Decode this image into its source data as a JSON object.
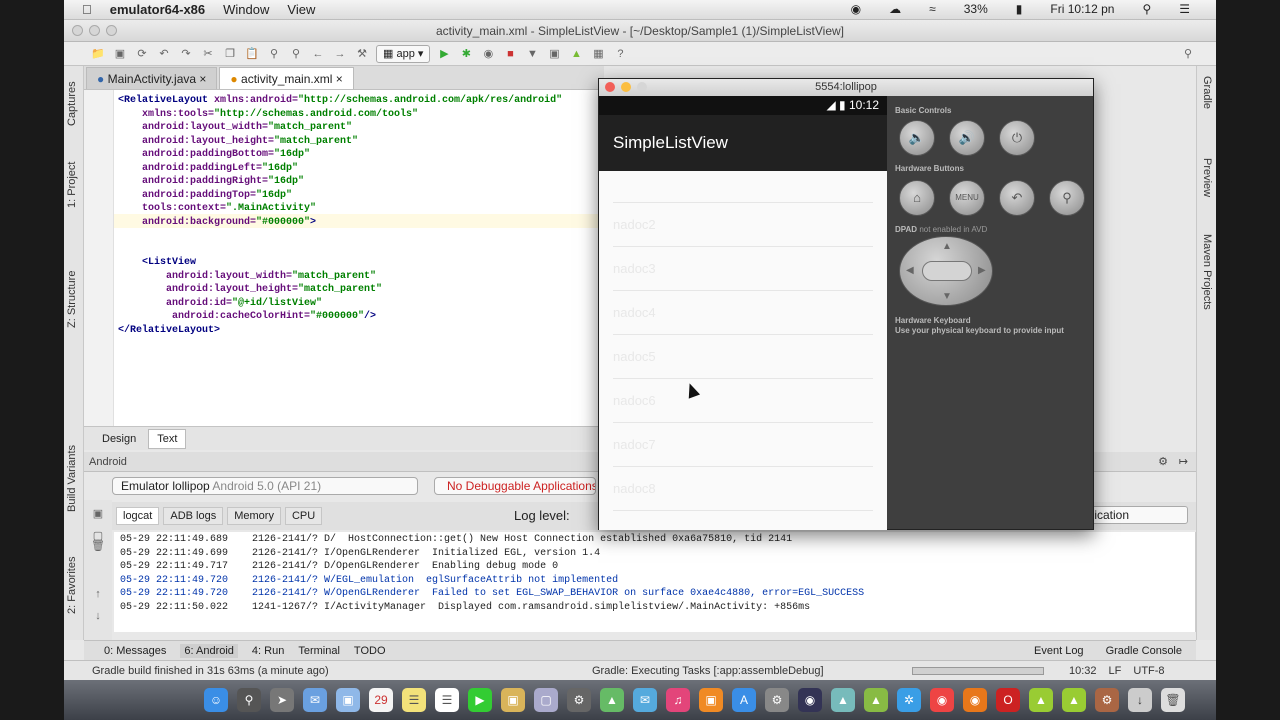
{
  "menubar": {
    "apple": "",
    "app_name": "emulator64-x86",
    "items": [
      "Window",
      "View"
    ],
    "battery": "33%",
    "clock": "Fri 10:12 pn"
  },
  "window": {
    "title": "activity_main.xml - SimpleListView - [~/Desktop/Sample1 (1)/SimpleListView]"
  },
  "toolbar": {
    "run_config": "app"
  },
  "left_tabs": [
    "Captures",
    "1: Project",
    "Z: Structure",
    "Build Variants",
    "2: Favorites"
  ],
  "right_tabs": [
    "Gradle",
    "Preview",
    "Maven Projects"
  ],
  "editor_tabs": [
    {
      "label": "MainActivity.java"
    },
    {
      "label": "activity_main.xml"
    }
  ],
  "code": [
    {
      "indent": 0,
      "tag": "<RelativeLayout",
      "attr": " xmlns:android=",
      "val": "\"http://schemas.android.com/apk/res/android\"",
      "end": ""
    },
    {
      "indent": 1,
      "tag": "",
      "attr": "xmlns:tools=",
      "val": "\"http://schemas.android.com/tools\"",
      "end": ""
    },
    {
      "indent": 1,
      "tag": "",
      "attr": "android:layout_width=",
      "val": "\"match_parent\"",
      "end": ""
    },
    {
      "indent": 1,
      "tag": "",
      "attr": "android:layout_height=",
      "val": "\"match_parent\"",
      "end": ""
    },
    {
      "indent": 1,
      "tag": "",
      "attr": "android:paddingBottom=",
      "val": "\"16dp\"",
      "end": ""
    },
    {
      "indent": 1,
      "tag": "",
      "attr": "android:paddingLeft=",
      "val": "\"16dp\"",
      "end": ""
    },
    {
      "indent": 1,
      "tag": "",
      "attr": "android:paddingRight=",
      "val": "\"16dp\"",
      "end": ""
    },
    {
      "indent": 1,
      "tag": "",
      "attr": "android:paddingTop=",
      "val": "\"16dp\"",
      "end": ""
    },
    {
      "indent": 1,
      "tag": "",
      "attr": "tools:context=",
      "val": "\".MainActivity\"",
      "end": ""
    },
    {
      "indent": 1,
      "tag": "",
      "attr": "android:background=",
      "val": "\"#000000\"",
      "end": ">"
    },
    {
      "indent": 0,
      "tag": "",
      "attr": "",
      "val": "",
      "end": ""
    },
    {
      "indent": 0,
      "tag": "",
      "attr": "",
      "val": "",
      "end": ""
    },
    {
      "indent": 1,
      "tag": "<ListView",
      "attr": "",
      "val": "",
      "end": ""
    },
    {
      "indent": 2,
      "tag": "",
      "attr": "android:layout_width=",
      "val": "\"match_parent\"",
      "end": ""
    },
    {
      "indent": 2,
      "tag": "",
      "attr": "android:layout_height=",
      "val": "\"match_parent\"",
      "end": ""
    },
    {
      "indent": 2,
      "tag": "",
      "attr": "android:id=",
      "val": "\"@+id/listView\"",
      "end": ""
    },
    {
      "indent": 2,
      "tag": "",
      "attr": " android:cacheColorHint=",
      "val": "\"#000000\"",
      "end": "/>"
    },
    {
      "indent": 0,
      "tag": "</RelativeLayout>",
      "attr": "",
      "val": "",
      "end": ""
    }
  ],
  "design_tabs": {
    "design": "Design",
    "text": "Text"
  },
  "android_panel": {
    "title": "Android",
    "device_name": "Emulator lollipop",
    "device_api": "Android 5.0 (API 21)",
    "process": "No Debuggable Applications",
    "log_tabs": [
      "logcat",
      "ADB logs",
      "Memory",
      "CPU"
    ],
    "log_level_label": "Log level:",
    "filter": "plication"
  },
  "log_lines": [
    {
      "level": "d",
      "text": "05-29 22:11:49.689    2126-2141/? D/  HostConnection::get() New Host Connection established 0xa6a75810, tid 2141"
    },
    {
      "level": "i",
      "text": "05-29 22:11:49.699    2126-2141/? I/OpenGLRenderer  Initialized EGL, version 1.4"
    },
    {
      "level": "d",
      "text": "05-29 22:11:49.717    2126-2141/? D/OpenGLRenderer  Enabling debug mode 0"
    },
    {
      "level": "w",
      "text": "05-29 22:11:49.720    2126-2141/? W/EGL_emulation  eglSurfaceAttrib not implemented"
    },
    {
      "level": "w",
      "text": "05-29 22:11:49.720    2126-2141/? W/OpenGLRenderer  Failed to set EGL_SWAP_BEHAVIOR on surface 0xae4c4880, error=EGL_SUCCESS"
    },
    {
      "level": "i",
      "text": "05-29 22:11:50.022    1241-1267/? I/ActivityManager  Displayed com.ramsandroid.simplelistview/.MainActivity: +856ms"
    }
  ],
  "bottom_tabs": {
    "left": [
      "0: Messages",
      "6: Android",
      "4: Run",
      "Terminal",
      "TODO"
    ],
    "right": [
      "Event Log",
      "Gradle Console"
    ]
  },
  "status": {
    "left": "Gradle build finished in 31s 63ms (a minute ago)",
    "middle": "Gradle: Executing Tasks [:app:assembleDebug]",
    "time": "10:32",
    "lf": "LF",
    "encoding": "UTF-8"
  },
  "emulator": {
    "title": "5554:lollipop",
    "clock": "10:12",
    "app_title": "SimpleListView",
    "list_items": [
      "",
      "nadoc2",
      "nadoc3",
      "nadoc4",
      "nadoc5",
      "nadoc6",
      "nadoc7",
      "nadoc8"
    ],
    "basic_controls": "Basic Controls",
    "hardware_buttons": "Hardware Buttons",
    "dpad_label": "DPAD",
    "dpad_note": "not enabled in AVD",
    "keyboard_label": "Hardware Keyboard",
    "keyboard_note": "Use your physical keyboard to provide input",
    "menu_label": "MENU"
  },
  "colors": {
    "emulator_bg": "#3f3f3f",
    "action_bar": "#212121",
    "error_text": "#cc2222",
    "warn_log": "#0033aa"
  }
}
